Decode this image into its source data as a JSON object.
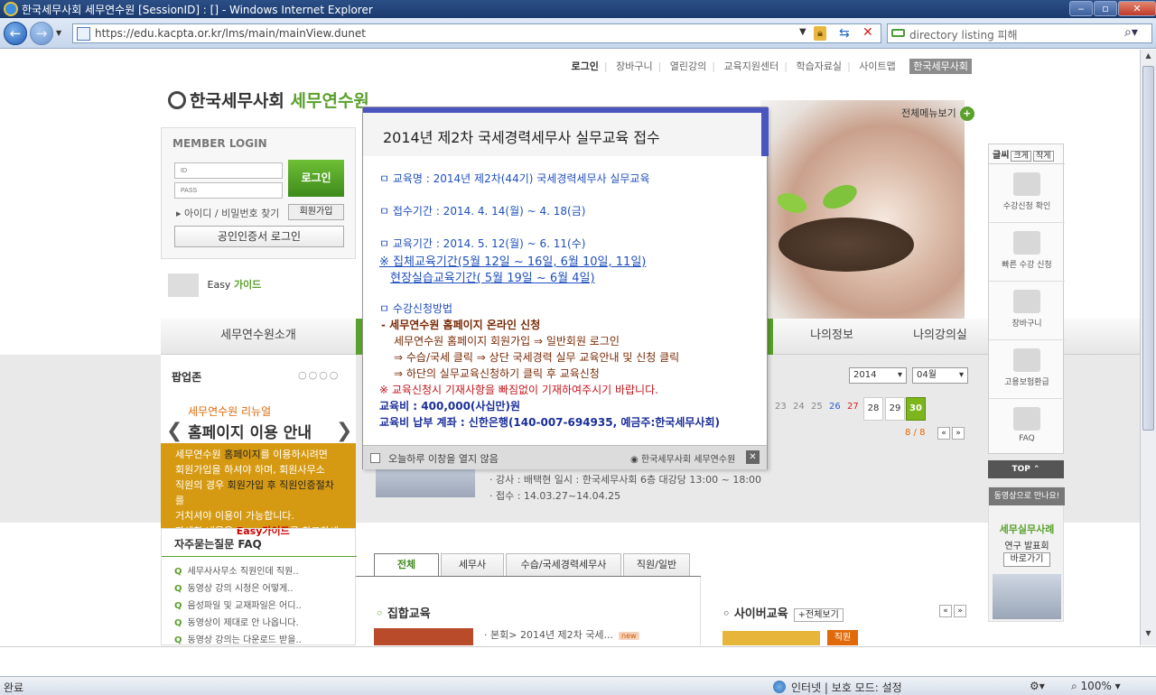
{
  "window": {
    "title": "한국세무사회 세무연수원 [SessionID] : [] - Windows Internet Explorer",
    "address": "https://edu.kacpta.or.kr/lms/main/mainView.dunet",
    "search_placeholder": "directory listing 피해",
    "status": "완료",
    "zone": "인터넷 | 보호 모드: 설정",
    "zoom": "100%"
  },
  "top_links": [
    "로그인",
    "장바구니",
    "열린강의",
    "교육지원센터",
    "학습자료실",
    "사이트맵",
    "한국세무사회"
  ],
  "logo": {
    "org": "한국세무사회",
    "name": "세무연수원"
  },
  "menu_all": "전체메뉴보기",
  "login": {
    "title": "MEMBER LOGIN",
    "id_placeholder": "ID",
    "pass_placeholder": "PASS",
    "login_btn": "로그인",
    "find": "아이디 / 비밀번호 찾기",
    "join": "회원가입",
    "cert": "공인인증서 로그인"
  },
  "easy_guide": {
    "a": "Easy",
    "b": "가이드"
  },
  "gnav": [
    "세무연수원소개",
    "나의정보",
    "나의강의실"
  ],
  "quick": {
    "font_label": "글씨",
    "big": "크게",
    "small": "작게",
    "items": [
      "수강신청 확인",
      "빠른 수강 신청",
      "장바구니",
      "고용보험환급",
      "FAQ"
    ],
    "top": "TOP ⌃"
  },
  "movie": {
    "head": "동영상으로 만나요!",
    "t1": "세무실무사례",
    "t2": "연구 발표회",
    "go": "바로가기"
  },
  "popupzone": {
    "title": "팝업존",
    "dots": "○○○○",
    "sub": "세무연수원 리뉴얼",
    "main": "홈페이지 이용 안내",
    "box": [
      {
        "pre": "세무연수원 ",
        "y": "홈페이지",
        "post": "를 이용하시려면"
      },
      {
        "pre": "회원가입을 하셔야 하며, 회원사무소",
        "y": "",
        "post": ""
      },
      {
        "pre": "직원의 경우 ",
        "y": "회원가입 후 직원인증절차",
        "post": "를"
      },
      {
        "pre": "거치셔야 이용이 가능합니다.",
        "y": "",
        "post": ""
      },
      {
        "pre": "자세한 내용은 ",
        "r": "Easy가이드",
        "post": "를 참고하세요."
      }
    ]
  },
  "faq": {
    "title": "자주묻는질문 FAQ",
    "items": [
      "세무사사무소 직원인데 직원..",
      "동영상 강의 시청은 어떻게..",
      "음성파일 및 교재파일은 어디..",
      "동영상이 제대로 안 나옵니다.",
      "동영상 강의는 다운로드 받을.."
    ]
  },
  "calendar": {
    "year": "2014",
    "month": "04월",
    "days": [
      "23",
      "24",
      "25",
      "26",
      "27",
      "28",
      "29",
      "30"
    ],
    "page": "8 / 8"
  },
  "lecture": {
    "line1": "·  강사 : 배택현 일시 : 한국세무사회 6층 대강당 13:00 ~ 18:00",
    "line2": "·  접수 : 14.03.27~14.04.25"
  },
  "tabs": [
    "전체",
    "세무사",
    "수습/국세경력세무사",
    "직원/일반"
  ],
  "collective": {
    "title": "집합교육",
    "item": "·  본회> 2014년 제2차 국세...",
    "new": "new"
  },
  "cyber": {
    "title": "사이버교육",
    "all": "+전체보기",
    "tag": "직원"
  },
  "popup": {
    "title": "2014년 제2차 국세경력세무사 실무교육 접수",
    "lines": [
      "ㅁ  교육명 : 2014년 제2차(44기) 국세경력세무사 실무교육",
      "ㅁ  접수기간 : 2014. 4. 14(월) ~ 4. 18(금)",
      "ㅁ  교육기간 : 2014. 5. 12(월) ~ 6. 11(수)",
      "※ 집체교육기간(5월 12일 ~ 16일, 6월 10일, 11일)",
      "현장실습교육기간( 5월 19일 ~ 6월 4일)",
      "ㅁ 수강신청방법",
      "- 세무연수원 홈페이지 온라인 신청",
      "세무연수원 홈페이지 회원가입 ⇒ 일반회원 로그인",
      "⇒ 수습/국세 클릭  ⇒ 상단 국세경력 실무 교육안내 및 신청 클릭",
      "⇒ 하단의 실무교육신청하기 클릭 후 교육신청",
      "※ 교육신청시 기재사항을 빠짐없이 기재하여주시기 바랍니다.",
      "교육비 : 400,000(사십만)원",
      "교육비 납부 계좌 : 신한은행(140-007-694935, 예금주:한국세무사회)"
    ],
    "dont_show": "오늘하루 이창을 열지 않음",
    "brand": "한국세무사회 세무연수원",
    "close": "✕"
  }
}
